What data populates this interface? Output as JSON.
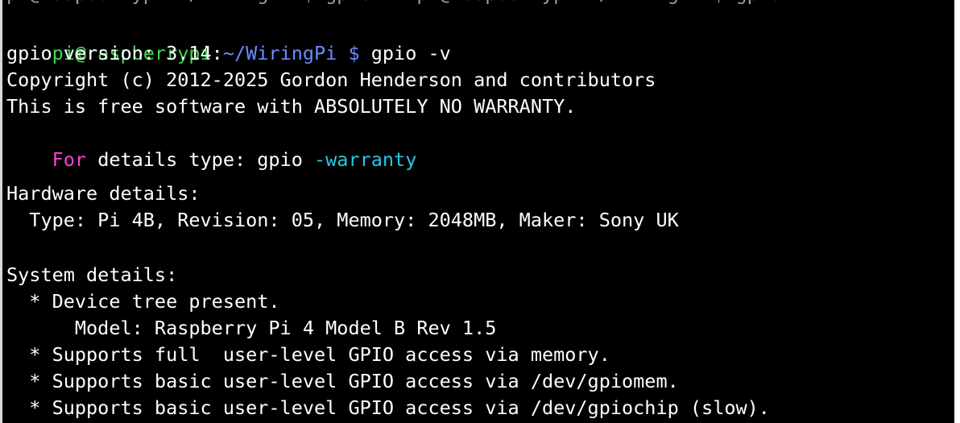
{
  "terminal": {
    "partial_top_line": "pi@raspberrypi:~/WiringPi $ gpio -v pi@raspberrypi:~/WiringPi $ gpio -v",
    "prompt": {
      "user_host": "pi@raspberrypi",
      "colon": ":",
      "path": "~/WiringPi",
      "dollar": " $",
      "command": " gpio -v"
    },
    "lines": {
      "version": "gpio version: 3.14",
      "copyright": "Copyright (c) 2012-2025 Gordon Henderson and contributors",
      "free_software": "This is free software with ABSOLUTELY NO WARRANTY.",
      "details_for": "For",
      "details_mid": " details type: gpio ",
      "details_flag": "-warranty",
      "hardware_heading": "Hardware details:",
      "hardware_info": "  Type: Pi 4B, Revision: 05, Memory: 2048MB, Maker: Sony UK",
      "system_heading": "System details:",
      "device_tree": "  * Device tree present.",
      "model": "      Model: Raspberry Pi 4 Model B Rev 1.5",
      "support_memory": "  * Supports full  user-level GPIO access via memory.",
      "support_gpiomem": "  * Supports basic user-level GPIO access via /dev/gpiomem.",
      "support_gpiochip": "  * Supports basic user-level GPIO access via /dev/gpiochip (slow)."
    },
    "colors": {
      "background": "#000000",
      "prompt_user": "#3ed850",
      "prompt_path": "#6b8cff",
      "keyword": "#ff3fd0",
      "flag": "#27c7e8",
      "text": "#ffffff"
    }
  }
}
